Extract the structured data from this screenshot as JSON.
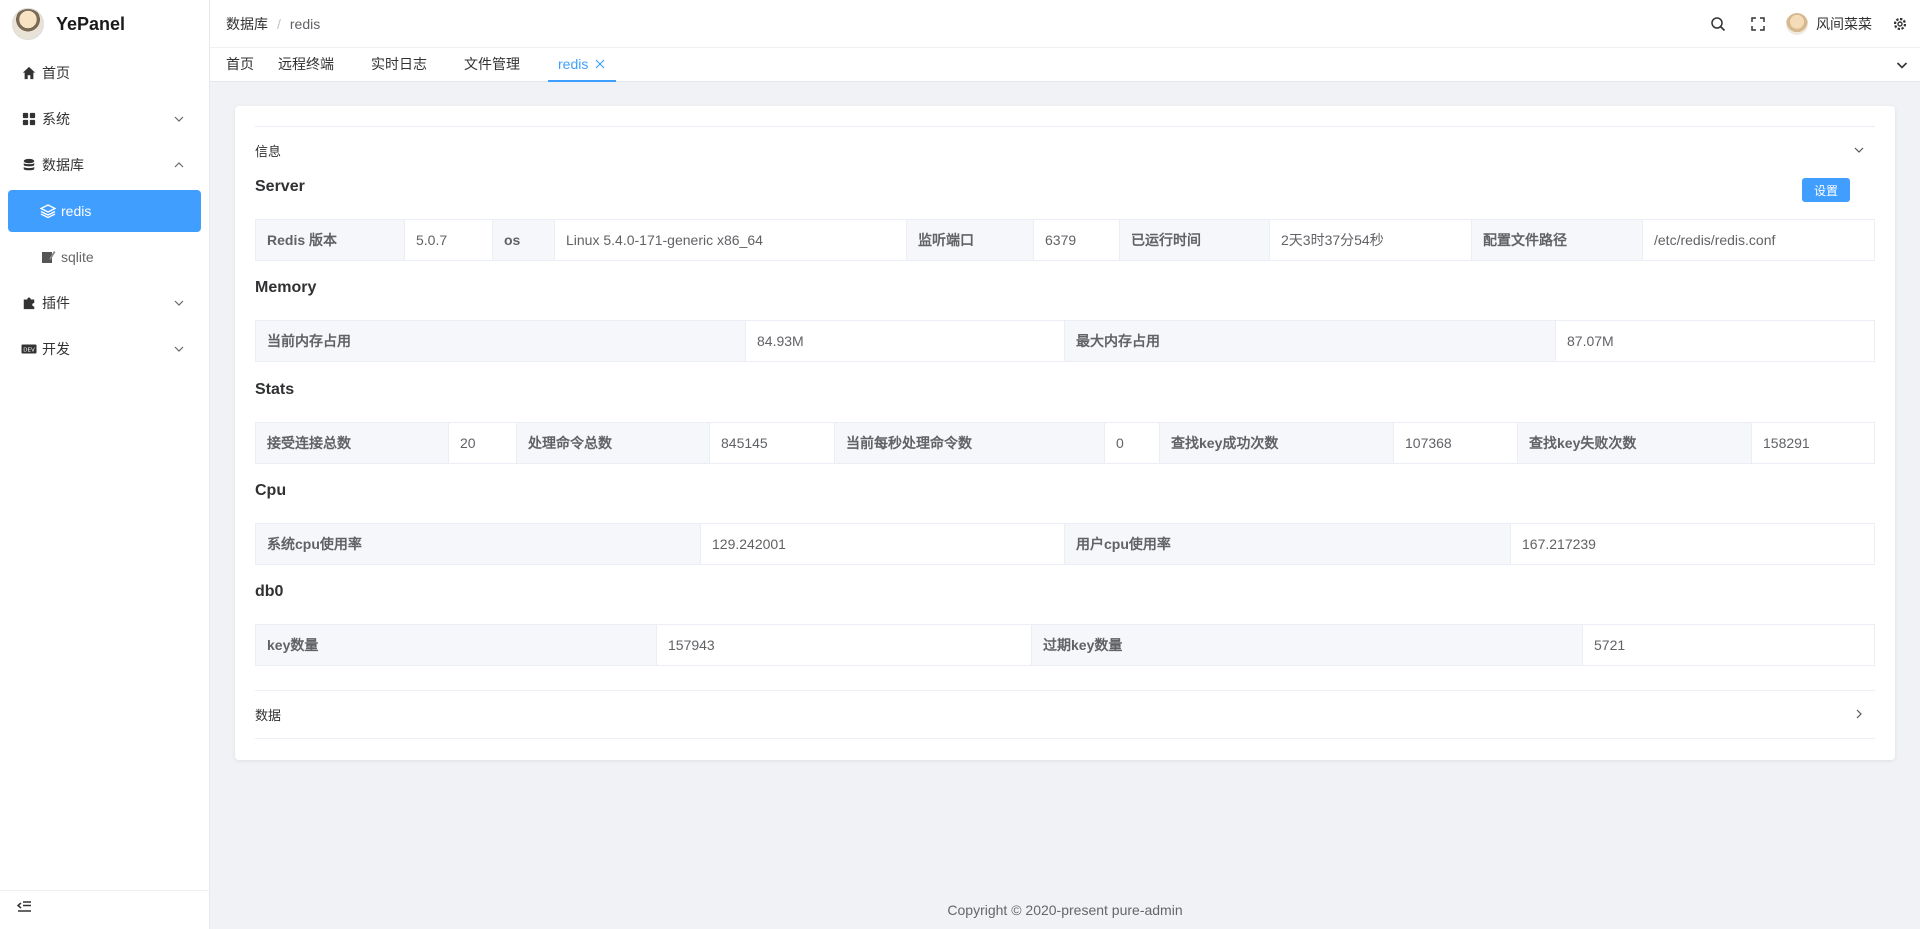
{
  "app": {
    "name": "YePanel"
  },
  "sidebar": {
    "items": [
      {
        "label": "首页",
        "icon": "home-icon"
      },
      {
        "label": "系统",
        "icon": "grid-icon"
      },
      {
        "label": "数据库",
        "icon": "database-icon"
      },
      {
        "label": "redis",
        "icon": "layers-icon"
      },
      {
        "label": "sqlite",
        "icon": "edit-icon"
      },
      {
        "label": "插件",
        "icon": "puzzle-icon"
      },
      {
        "label": "开发",
        "icon": "dev-icon"
      }
    ]
  },
  "header": {
    "breadcrumb": [
      "数据库",
      "/",
      "redis"
    ],
    "username": "风间菜菜"
  },
  "tabs": [
    "首页",
    "远程终端",
    "实时日志",
    "文件管理",
    "redis"
  ],
  "panel": {
    "info_title": "信息",
    "data_title": "数据",
    "settings_label": "设置"
  },
  "server": {
    "title": "Server",
    "fields": [
      {
        "label": "Redis 版本",
        "value": "5.0.7"
      },
      {
        "label": "os",
        "value": "Linux 5.4.0-171-generic x86_64"
      },
      {
        "label": "监听端口",
        "value": "6379"
      },
      {
        "label": "已运行时间",
        "value": "2天3时37分54秒"
      },
      {
        "label": "配置文件路径",
        "value": "/etc/redis/redis.conf"
      }
    ]
  },
  "memory": {
    "title": "Memory",
    "fields": [
      {
        "label": "当前内存占用",
        "value": "84.93M"
      },
      {
        "label": "最大内存占用",
        "value": "87.07M"
      }
    ]
  },
  "stats": {
    "title": "Stats",
    "fields": [
      {
        "label": "接受连接总数",
        "value": "20"
      },
      {
        "label": "处理命令总数",
        "value": "845145"
      },
      {
        "label": "当前每秒处理命令数",
        "value": "0"
      },
      {
        "label": "查找key成功次数",
        "value": "107368"
      },
      {
        "label": "查找key失败次数",
        "value": "158291"
      }
    ]
  },
  "cpu": {
    "title": "Cpu",
    "fields": [
      {
        "label": "系统cpu使用率",
        "value": "129.242001"
      },
      {
        "label": "用户cpu使用率",
        "value": "167.217239"
      }
    ]
  },
  "db0": {
    "title": "db0",
    "fields": [
      {
        "label": "key数量",
        "value": "157943"
      },
      {
        "label": "过期key数量",
        "value": "5721"
      }
    ]
  },
  "footer": {
    "copyright": "Copyright © 2020-present pure-admin"
  },
  "colors": {
    "accent": "#409eff",
    "background": "#f0f2f5"
  }
}
